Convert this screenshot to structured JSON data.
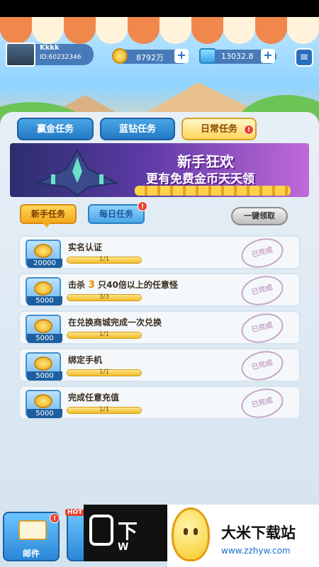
{
  "player": {
    "name": "Kkkk",
    "id": "ID:60232346"
  },
  "resources": {
    "coins": "8792万",
    "diamonds": "13032.8",
    "plus": "+",
    "menu": "≡"
  },
  "tabs": {
    "gold": "赢金任务",
    "blue_diamond": "蓝钻任务",
    "daily": "日常任务",
    "badge": "!"
  },
  "banner": {
    "title": "新手狂欢",
    "subtitle": "更有免费金币天天领"
  },
  "subtabs": {
    "newbie": "新手任务",
    "daily": "每日任务",
    "badge": "!",
    "claim_all": "一键领取"
  },
  "tasks": [
    {
      "title": "实名认证",
      "reward": "20000",
      "progress": "1/1",
      "progress_value": 1.0,
      "status": "已完成"
    },
    {
      "title_pre": "击杀",
      "title_num": "3",
      "title_post": "只40倍以上的任意怪",
      "reward": "5000",
      "progress": "3/3",
      "progress_value": 1.0,
      "status": "已完成"
    },
    {
      "title": "在兑换商城完成一次兑换",
      "reward": "5000",
      "progress": "1/1",
      "progress_value": 1.0,
      "status": "已完成"
    },
    {
      "title": "绑定手机",
      "reward": "5000",
      "progress": "1/1",
      "progress_value": 1.0,
      "status": "已完成"
    },
    {
      "title": "完成任意充值",
      "reward": "5000",
      "progress": "1/1",
      "progress_value": 1.0,
      "status": "已完成"
    }
  ],
  "bottom": {
    "mail_label": "邮件",
    "hot_tag": "HOT",
    "badge": "!"
  },
  "watermark": {
    "dark_text": "下",
    "dark_sub": "W",
    "site_name": "大米下载站",
    "site_url": "www.zzhyw.com"
  },
  "colors": {
    "accent_blue": "#2379c4",
    "accent_gold": "#f5a818",
    "badge_red": "#e8412e",
    "stamp": "#c8a6c8"
  }
}
